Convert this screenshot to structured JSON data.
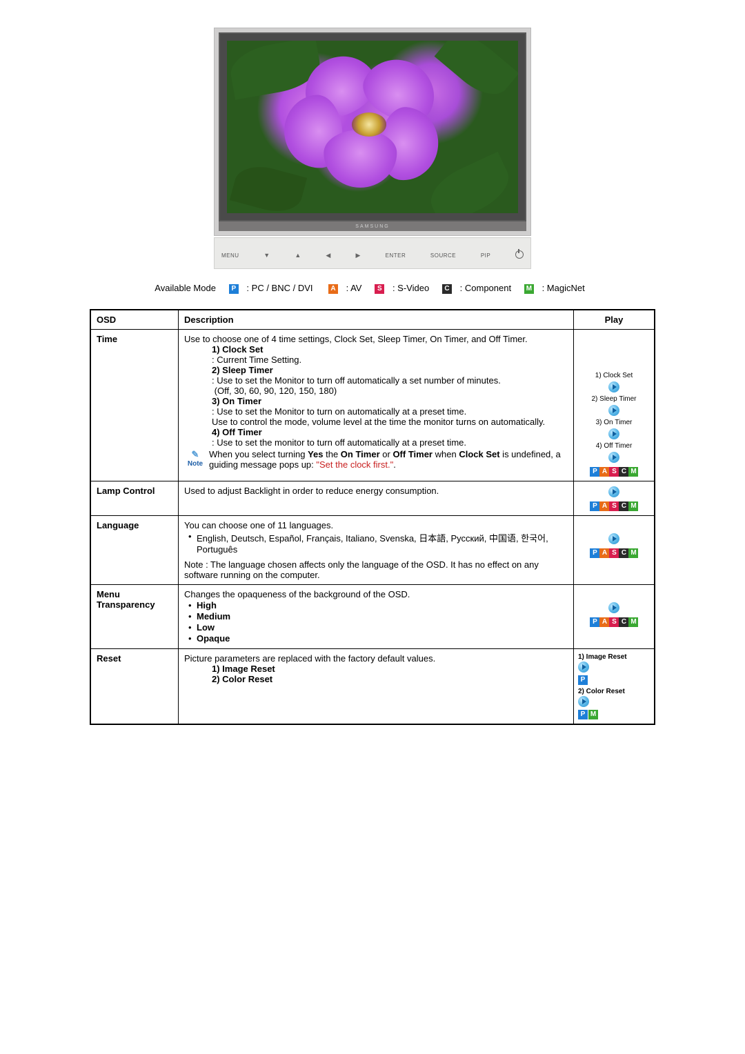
{
  "monitor": {
    "brand": "SAMSUNG",
    "controls": [
      "MENU",
      "▼",
      "▲",
      "◀",
      "▶",
      "ENTER",
      "SOURCE",
      "PIP"
    ]
  },
  "mode_line": {
    "label": "Available Mode",
    "modes": [
      {
        "letter": "P",
        "text": ": PC / BNC / DVI",
        "class": "badge-P"
      },
      {
        "letter": "A",
        "text": ": AV",
        "class": "badge-A"
      },
      {
        "letter": "S",
        "text": ": S-Video",
        "class": "badge-S"
      },
      {
        "letter": "C",
        "text": ": Component",
        "class": "badge-C"
      },
      {
        "letter": "M",
        "text": ": MagicNet",
        "class": "badge-M"
      }
    ]
  },
  "table": {
    "headers": {
      "osd": "OSD",
      "desc": "Description",
      "play": "Play"
    },
    "rows": {
      "time": {
        "osd": "Time",
        "intro": "Use to choose one of 4 time settings, Clock Set, Sleep Timer, On Timer, and Off Timer.",
        "items": [
          {
            "heading": "1) Clock Set",
            "body": ": Current Time Setting."
          },
          {
            "heading": "2) Sleep Timer",
            "body": ": Use to set the Monitor to turn off automatically a set number of minutes.",
            "extra": "(Off, 30, 60, 90, 120, 150, 180)"
          },
          {
            "heading": "3) On Timer",
            "body": ": Use to set the Monitor to turn on automatically at a preset time.",
            "body2": "Use to control the mode, volume level at the time the monitor turns on automatically."
          },
          {
            "heading": "4) Off Timer",
            "body": ": Use to set the monitor to turn off automatically at a preset time."
          }
        ],
        "note_label": "Note",
        "note_pre": "When you select turning ",
        "note_yes": "Yes",
        "note_mid1": " the ",
        "note_on": "On Timer",
        "note_or": " or ",
        "note_off": "Off Timer",
        "note_mid2": " when ",
        "note_clock": "Clock Set",
        "note_tail": " is undefined, a guiding message pops up: ",
        "note_quote": "\"Set the clock first.\"",
        "note_dot": ".",
        "play_items": [
          "1) Clock Set",
          "2) Sleep Timer",
          "3) On Timer",
          "4) Off Timer"
        ],
        "play_badges": [
          "P",
          "A",
          "S",
          "C",
          "M"
        ]
      },
      "lamp": {
        "osd": "Lamp Control",
        "body": "Used to adjust Backlight in order to reduce energy consumption.",
        "play_badges": [
          "P",
          "A",
          "S",
          "C",
          "M"
        ]
      },
      "language": {
        "osd": "Language",
        "intro": "You can choose one of 11 languages.",
        "langs": "English, Deutsch, Español, Français, Italiano, Svenska, 日本語, Русский, 中国语, 한국어,  Português",
        "note": "Note : The language chosen affects only the language of the OSD. It has no effect on any software running on the computer.",
        "play_badges": [
          "P",
          "A",
          "S",
          "C",
          "M"
        ]
      },
      "menu": {
        "osd": "Menu Transparency",
        "intro": "Changes the opaqueness of the background of the OSD.",
        "options": [
          "High",
          "Medium",
          "Low",
          "Opaque"
        ],
        "play_badges": [
          "P",
          "A",
          "S",
          "C",
          "M"
        ]
      },
      "reset": {
        "osd": "Reset",
        "intro": "Picture parameters are replaced with the factory default values.",
        "items": [
          "1) Image Reset",
          "2) Color Reset"
        ],
        "play1": "1) Image Reset",
        "play2": "2) Color Reset"
      }
    }
  }
}
